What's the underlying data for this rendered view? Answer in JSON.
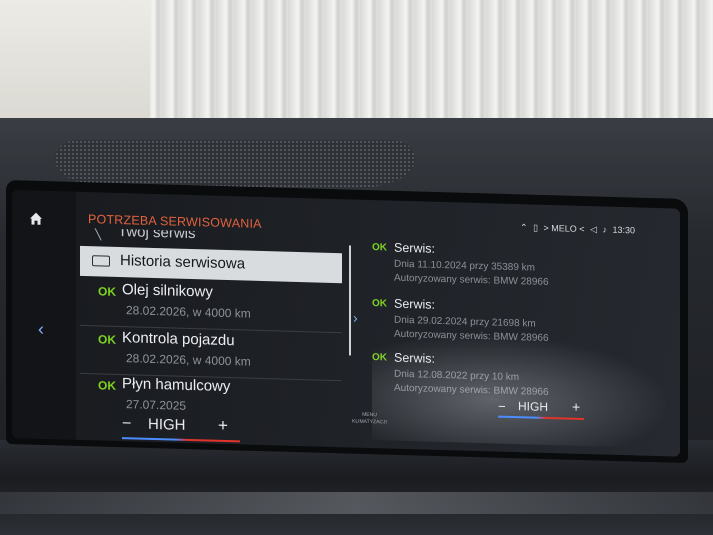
{
  "screen": {
    "title": "POTRZEBA SERWISOWANIA",
    "status_bar": {
      "source": "> MELO <",
      "time": "13:30"
    },
    "list": {
      "partial_item": "Twój serwis",
      "selected_item": "Historia serwisowa",
      "items": [
        {
          "status": "OK",
          "name": "Olej silnikowy",
          "detail": "28.02.2026, w 4000 km"
        },
        {
          "status": "OK",
          "name": "Kontrola pojazdu",
          "detail": "28.02.2026, w 4000 km"
        },
        {
          "status": "OK",
          "name": "Płyn hamulcowy",
          "detail": "27.07.2025"
        }
      ]
    },
    "service_history": [
      {
        "status": "OK",
        "title": "Serwis:",
        "line1": "Dnia 11.10.2024 przy 35389 km",
        "line2": "Autoryzowany serwis: BMW 28966"
      },
      {
        "status": "OK",
        "title": "Serwis:",
        "line1": "Dnia 29.02.2024 przy 21698 km",
        "line2": "Autoryzowany serwis: BMW 28966"
      },
      {
        "status": "OK",
        "title": "Serwis:",
        "line1": "Dnia 12.08.2022 przy 10 km",
        "line2": "Autoryzowany serwis: BMW 28966"
      }
    ],
    "climate_left": {
      "minus": "−",
      "value": "HIGH",
      "plus": "+"
    },
    "climate_right": {
      "minus": "−",
      "value": "HIGH",
      "plus": "+"
    },
    "menu_label_1": "MENU",
    "menu_label_2": "KLIMATYZACJI"
  },
  "colors": {
    "title": "#e2623d",
    "ok": "#7ed321",
    "accent": "#7fb2ff",
    "cold": "#4c8cff",
    "hot": "#e0342b"
  }
}
